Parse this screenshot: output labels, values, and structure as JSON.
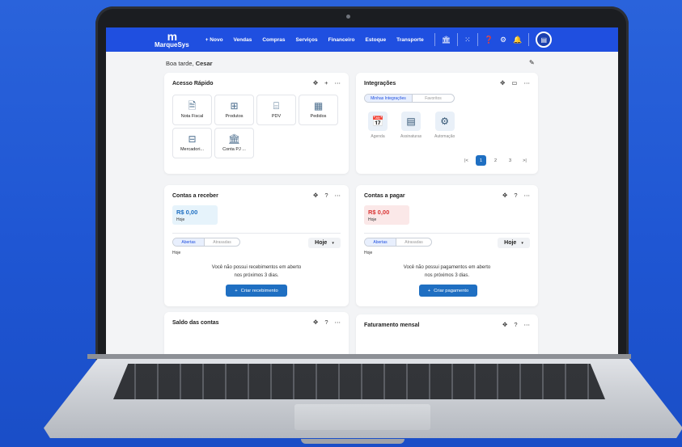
{
  "nav": {
    "logo_mark": "m",
    "logo_text": "MarqueSys",
    "items": [
      "+ Novo",
      "Vendas",
      "Compras",
      "Serviços",
      "Financeiro",
      "Estoque",
      "Transporte"
    ]
  },
  "greeting": {
    "prefix": "Boa tarde, ",
    "name": "Cesar"
  },
  "quick_access": {
    "title": "Acesso Rápido",
    "items": [
      "Nota Fiscal",
      "Produtos",
      "PDV",
      "Pedidos",
      "Mercadori...",
      "Conta PJ ..."
    ]
  },
  "integrations": {
    "title": "Integrações",
    "tabs": [
      "Minhas Integrações",
      "Favoritos"
    ],
    "items": [
      "Agenda",
      "Assinaturas",
      "Automação"
    ],
    "pages": [
      "|<",
      "1",
      "2",
      "3",
      ">|"
    ]
  },
  "receivables": {
    "title": "Contas a receber",
    "amount": "R$ 0,00",
    "amount_caption": "Hoje",
    "tabs": [
      "Abertas",
      "Atrasadas"
    ],
    "period": "Hoje",
    "period_caption": "Hoje",
    "message_line1": "Você não possui recebimentos em aberto",
    "message_line2": "nos próximos 3 dias.",
    "button": "Criar recebimento"
  },
  "payables": {
    "title": "Contas a pagar",
    "amount": "R$ 0,00",
    "amount_caption": "Hoje",
    "tabs": [
      "Abertas",
      "Atrasadas"
    ],
    "period": "Hoje",
    "period_caption": "Hoje",
    "message_line1": "Você não possui pagamentos em aberto",
    "message_line2": "nos próximos 3 dias.",
    "button": "Criar pagamento"
  },
  "balances": {
    "title": "Saldo das contas"
  },
  "billing": {
    "title": "Faturamento mensal"
  },
  "colors": {
    "brand": "#1f4fe0",
    "button": "#1f6fc2",
    "receivable_bg": "#e6f3fb",
    "payable_bg": "#fbe8e8",
    "payable_text": "#d93434"
  }
}
